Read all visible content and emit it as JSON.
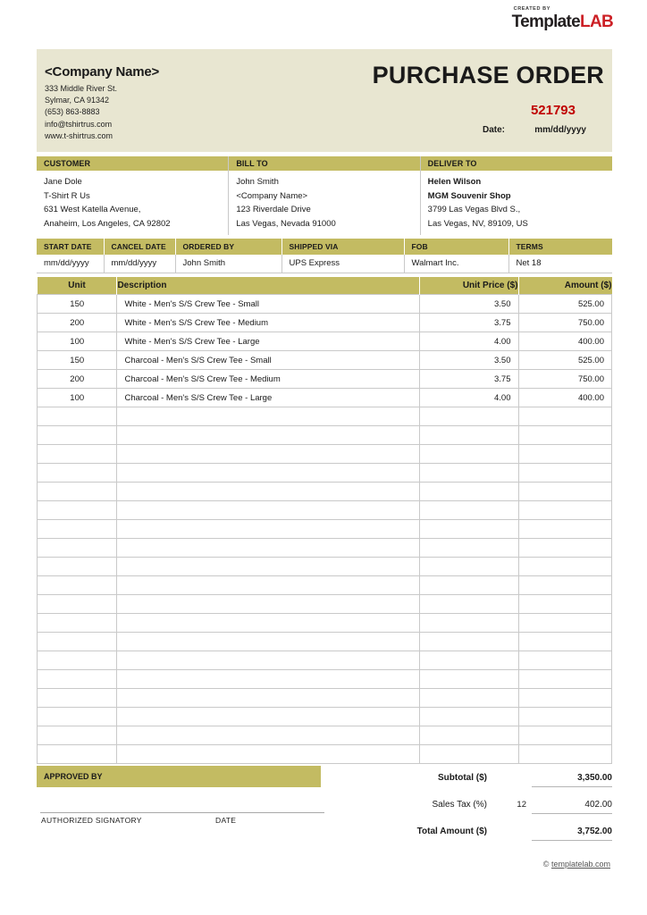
{
  "brand": {
    "created_by": "CREATED BY",
    "name_part1": "Template",
    "name_part2": "LAB"
  },
  "header": {
    "company_name": "<Company Name>",
    "company_address": [
      "333 Middle River St.",
      "Sylmar, CA 91342",
      "(653) 863-8883",
      "info@tshirtrus.com",
      "www.t-shirtrus.com"
    ],
    "title": "PURCHASE ORDER",
    "order_number": "521793",
    "date_label": "Date:",
    "date_value": "mm/dd/yyyy",
    "accent_color": "#c00000",
    "band_color": "#e8e6d1"
  },
  "addresses": [
    {
      "heading": "CUSTOMER",
      "lines": [
        "Jane Dole",
        "T-Shirt R Us",
        "631 West Katella Avenue,",
        "Anaheim, Los Angeles, CA  92802"
      ],
      "bold_lines": 0
    },
    {
      "heading": "BILL TO",
      "lines": [
        "John Smith",
        "<Company Name>",
        "123 Riverdale Drive",
        "Las Vegas, Nevada  91000"
      ],
      "bold_lines": 0
    },
    {
      "heading": "DELIVER TO",
      "lines": [
        "Helen Wilson",
        "MGM Souvenir Shop",
        "3799 Las Vegas Blvd S.,",
        "Las Vegas, NV, 89109, US"
      ],
      "bold_lines": 2
    }
  ],
  "shipping": {
    "headers": [
      "START DATE",
      "CANCEL DATE",
      "ORDERED BY",
      "SHIPPED VIA",
      "FOB",
      "TERMS"
    ],
    "values": [
      "mm/dd/yyyy",
      "mm/dd/yyyy",
      "John Smith",
      "UPS Express",
      "Walmart Inc.",
      "Net 18"
    ]
  },
  "items": {
    "headers": [
      "Unit",
      "Description",
      "Unit Price ($)",
      "Amount ($)"
    ],
    "rows": [
      {
        "unit": "150",
        "description": "White - Men's  S/S Crew Tee - Small",
        "price": "3.50",
        "amount": "525.00"
      },
      {
        "unit": "200",
        "description": "White - Men's S/S Crew Tee - Medium",
        "price": "3.75",
        "amount": "750.00"
      },
      {
        "unit": "100",
        "description": "White - Men's S/S Crew Tee - Large",
        "price": "4.00",
        "amount": "400.00"
      },
      {
        "unit": "150",
        "description": "Charcoal - Men's S/S Crew Tee - Small",
        "price": "3.50",
        "amount": "525.00"
      },
      {
        "unit": "200",
        "description": "Charcoal - Men's S/S Crew Tee - Medium",
        "price": "3.75",
        "amount": "750.00"
      },
      {
        "unit": "100",
        "description": "Charcoal - Men's S/S Crew Tee - Large",
        "price": "4.00",
        "amount": "400.00"
      }
    ],
    "empty_row_count": 19
  },
  "footer": {
    "approved_by": "APPROVED BY",
    "authorized_signatory": "AUTHORIZED SIGNATORY",
    "date": "DATE",
    "subtotal_label": "Subtotal ($)",
    "subtotal_value": "3,350.00",
    "sales_tax_label": "Sales Tax (%)",
    "sales_tax_rate": "12",
    "sales_tax_value": "402.00",
    "total_label": "Total Amount ($)",
    "total_value": "3,752.00",
    "copyright_symbol": "©",
    "copyright_site": "templatelab.com"
  }
}
